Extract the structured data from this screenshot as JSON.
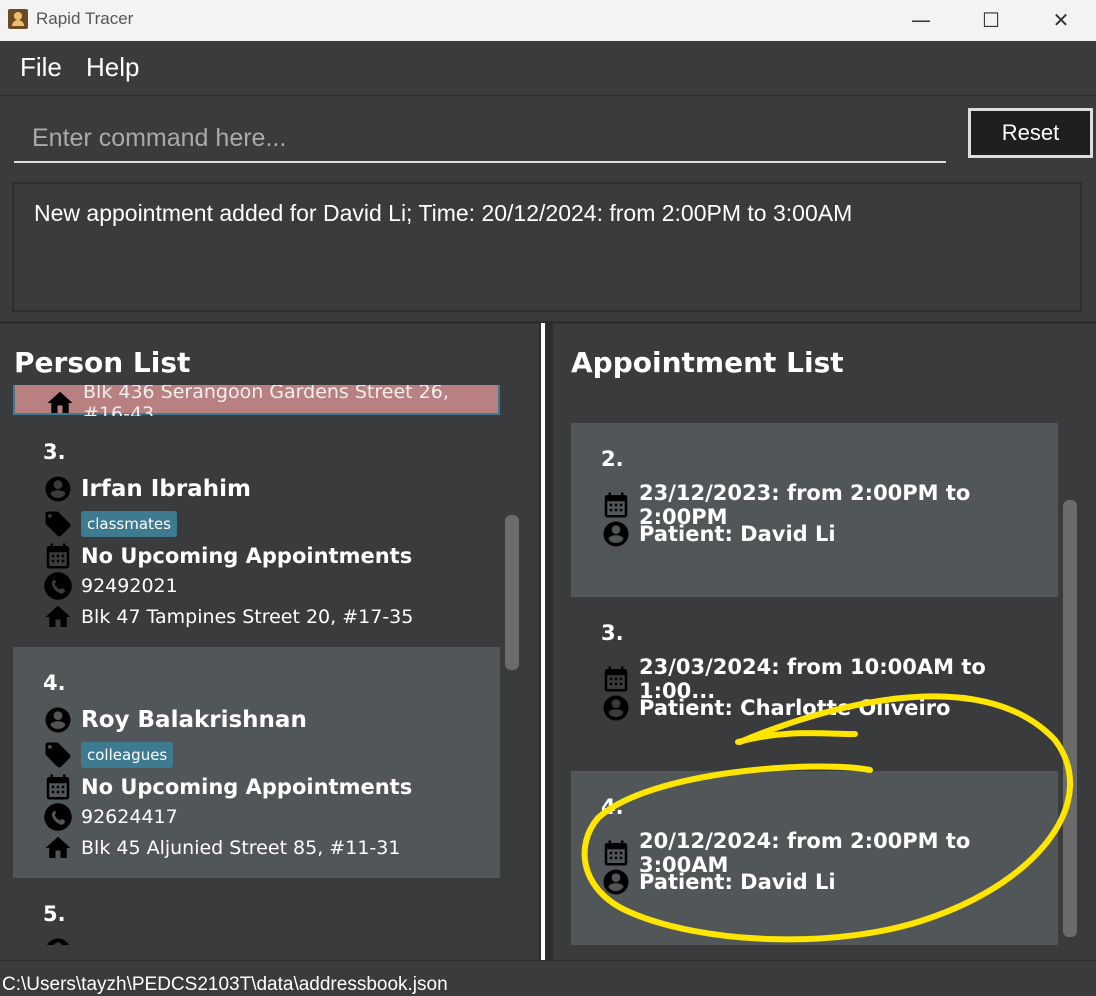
{
  "window": {
    "title": "Rapid Tracer",
    "minimize": "—",
    "maximize": "☐",
    "close": "✕"
  },
  "menu": {
    "file": "File",
    "help": "Help"
  },
  "command": {
    "placeholder": "Enter command here...",
    "reset_label": "Reset"
  },
  "result": {
    "text": "New appointment added for David Li; Time: 20/12/2024: from 2:00PM to 3:00AM"
  },
  "person_list": {
    "title": "Person List",
    "top_partial_address": "Blk 436 Serangoon Gardens Street 26, #16-43",
    "persons": [
      {
        "index": "3.",
        "name": "Irfan Ibrahim",
        "tag": "classmates",
        "appointment": "No Upcoming Appointments",
        "phone": "92492021",
        "address": "Blk 47 Tampines Street 20, #17-35"
      },
      {
        "index": "4.",
        "name": "Roy Balakrishnan",
        "tag": "colleagues",
        "appointment": "No Upcoming Appointments",
        "phone": "92624417",
        "address": "Blk 45 Aljunied Street 85, #11-31"
      },
      {
        "index": "5.",
        "name": "",
        "tag": "",
        "appointment": "",
        "phone": "",
        "address": ""
      }
    ]
  },
  "appointment_list": {
    "title": "Appointment List",
    "appointments": [
      {
        "index": "2.",
        "time": "23/12/2023: from 2:00PM to 2:00PM",
        "patient": "Patient: David Li"
      },
      {
        "index": "3.",
        "time": "23/03/2024: from 10:00AM to 1:00...",
        "patient": "Patient: Charlotte Oliveiro"
      },
      {
        "index": "4.",
        "time": "20/12/2024: from 2:00PM to 3:00AM",
        "patient": "Patient: David Li"
      }
    ]
  },
  "status": {
    "path": "C:\\Users\\tayzh\\PEDCS2103T\\data\\addressbook.json"
  },
  "colors": {
    "card_dark": "#3a3b3d",
    "card_light": "#515658",
    "tag": "#3e7b91",
    "selected": "#b88080",
    "annotation": "#ffe600"
  }
}
